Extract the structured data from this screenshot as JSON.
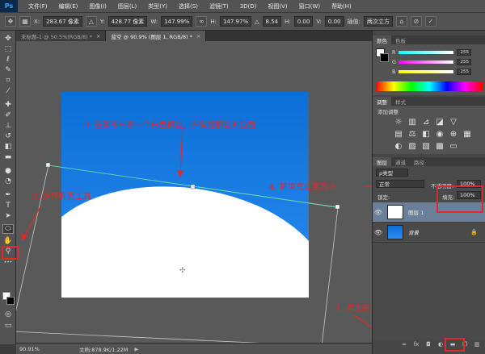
{
  "app": {
    "logo": "Ps"
  },
  "menu": [
    "文件(F)",
    "编辑(E)",
    "图像(I)",
    "图层(L)",
    "类型(Y)",
    "选择(S)",
    "滤镜(T)",
    "3D(D)",
    "视图(V)",
    "窗口(W)",
    "帮助(H)"
  ],
  "options": {
    "x_label": "X:",
    "x_value": "283.67 像素",
    "y_label": "Y:",
    "y_value": "428.77 像素",
    "w_label": "W:",
    "w_value": "147.99%",
    "h_label": "H:",
    "h_value": "147.97%",
    "angle_value": "8.54",
    "hskew_label": "H:",
    "hskew_value": "0.00",
    "vskew_label": "V:",
    "vskew_value": "0.00",
    "interp_label": "插值:",
    "interp_value": "两次立方"
  },
  "tabs": [
    {
      "label": "未标题-1 @ 50.5%(RGB/8) *",
      "close": "×"
    },
    {
      "label": "蓝空 @ 90.9% (图层 1, RGB/8) *",
      "close": "×"
    }
  ],
  "status": {
    "zoom": "90.91%",
    "doc": "文档:878.9K/1.22M"
  },
  "color_panel": {
    "tabs": [
      "颜色",
      "色板"
    ],
    "sliders": [
      {
        "letter": "R",
        "value": "255"
      },
      {
        "letter": "G",
        "value": "255"
      },
      {
        "letter": "B",
        "value": "255"
      }
    ]
  },
  "adjust_panel": {
    "tabs": [
      "调整",
      "样式"
    ],
    "title": "添加调整"
  },
  "layers_panel": {
    "tabs": [
      "图层",
      "通道",
      "路径"
    ],
    "kind_filter": "ρ类型",
    "blend_mode": "正常",
    "opacity_label": "不透明度:",
    "opacity_value": "100%",
    "lock_label": "锁定:",
    "fill_label": "填充:",
    "fill_value": "100%",
    "layers": [
      {
        "name": "图层 1",
        "visible": "👁",
        "selected": true
      },
      {
        "name": "背景",
        "visible": "👁",
        "lock": "🔒"
      }
    ],
    "footer_icons": [
      "link-icon",
      "fx-icon",
      "mask-icon",
      "adjustment-icon",
      "folder-icon",
      "new-layer-icon",
      "trash-icon"
    ]
  },
  "annotations": {
    "step1": "1. 点击新建图层",
    "step2": "2. 选择椭圆工具",
    "step3": "3. 在画布中画一个白色椭圆，并调整椭圆的位置",
    "step4": "4. 将填充设置为 0"
  },
  "colors": {
    "sky_top": "#0a6fd6",
    "sky_bottom": "#2a8cf0",
    "annotation": "#e02a2a",
    "selected_layer": "#6b7f9a"
  }
}
